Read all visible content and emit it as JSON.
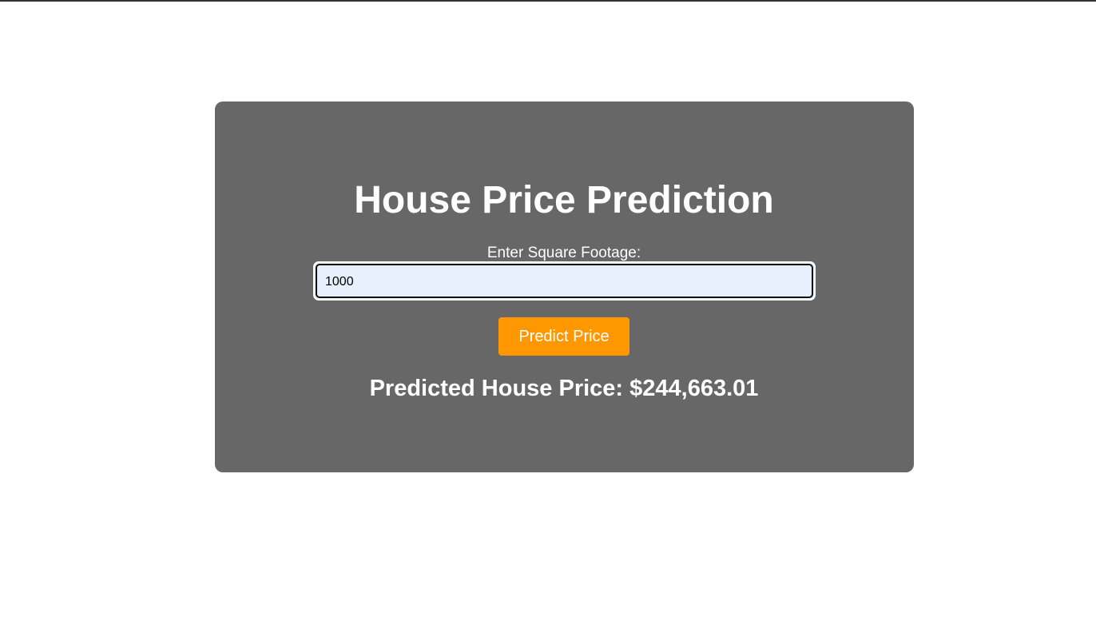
{
  "page": {
    "title": "House Price Prediction",
    "colors": {
      "card_background": "#676767",
      "button_background": "#ff9800",
      "input_background": "#e8f0fe",
      "text": "#ffffff"
    }
  },
  "form": {
    "label": "Enter Square Footage:",
    "input_value": "1000",
    "button_label": "Predict Price"
  },
  "result": {
    "text": "Predicted House Price: $244,663.01"
  }
}
